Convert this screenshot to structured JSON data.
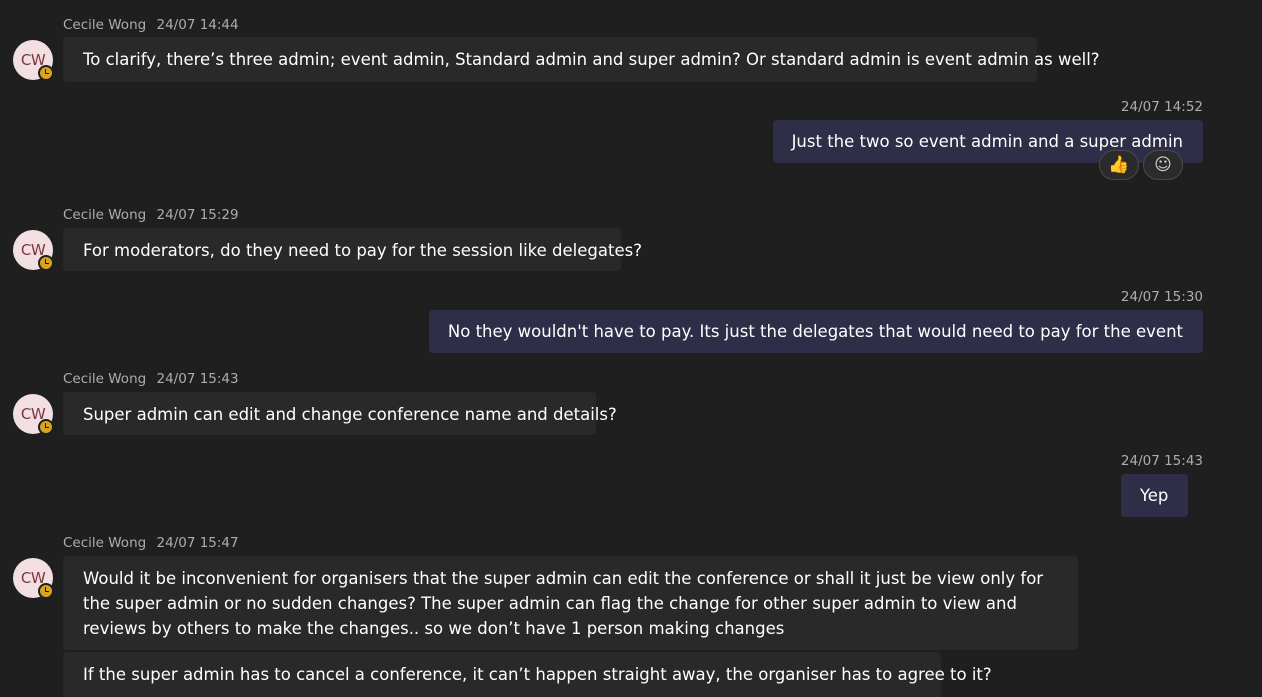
{
  "messages": [
    {
      "sender": "Cecile Wong",
      "initials": "CW",
      "time": "24/07 14:44",
      "text": "To clarify, there’s three admin; event admin, Standard admin and super admin? Or standard admin is event admin as well?"
    },
    {
      "time": "24/07 14:52",
      "text": "Just the two so event admin and a super admin",
      "reactions": [
        {
          "icon": "thumbs-up-icon",
          "glyph": "👍"
        },
        {
          "icon": "add-reaction-icon",
          "glyph": "☺"
        }
      ]
    },
    {
      "sender": "Cecile Wong",
      "initials": "CW",
      "time": "24/07 15:29",
      "text": "For moderators, do they need to pay for the session like delegates?"
    },
    {
      "time": "24/07 15:30",
      "text": "No they wouldn't have to pay. Its just the delegates that would need to pay for the event"
    },
    {
      "sender": "Cecile Wong",
      "initials": "CW",
      "time": "24/07 15:43",
      "text": "Super admin can edit and change conference name and details?"
    },
    {
      "time": "24/07 15:43",
      "text": "Yep"
    },
    {
      "sender": "Cecile Wong",
      "initials": "CW",
      "time": "24/07 15:47",
      "text": "Would it be inconvenient for organisers that the super admin can edit the conference or shall it just be  view only for the super admin or no sudden changes? The super admin can flag the change for other super admin to view and reviews by others  to make the changes.. so we don’t have 1 person making changes"
    },
    {
      "text": "If the super admin has to cancel a conference, it can’t happen straight away,  the organiser has to agree to it?"
    }
  ],
  "colors": {
    "background": "#1f1f1f",
    "incoming_bubble": "#292929",
    "outgoing_bubble": "#2e2e48",
    "avatar_bg": "#f1dfe1",
    "avatar_text": "#7a3740",
    "status_away": "#d6a420",
    "meta_text": "#adadad"
  }
}
